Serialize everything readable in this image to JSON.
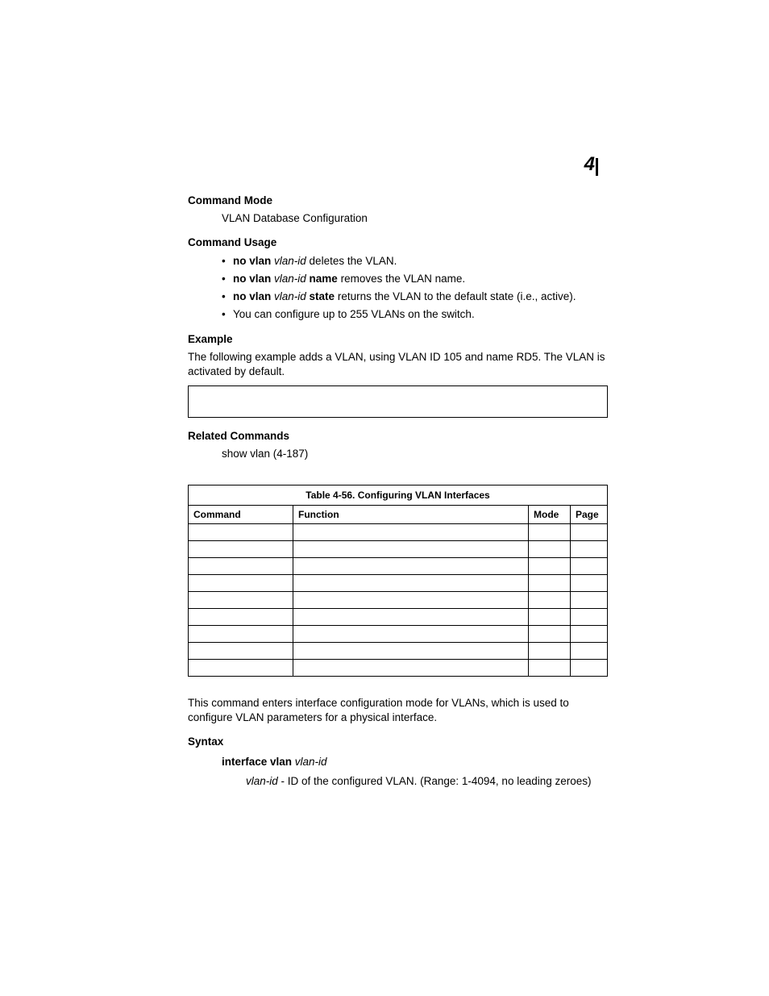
{
  "chapter": "4",
  "sections": {
    "command_mode": {
      "heading": "Command Mode",
      "text": "VLAN Database Configuration"
    },
    "command_usage": {
      "heading": "Command Usage",
      "bullets": [
        {
          "pre": "no vlan ",
          "param": "vlan-id",
          "post": " deletes the VLAN."
        },
        {
          "pre": "no vlan ",
          "param": "vlan-id",
          "kw": " name",
          "post": " removes the VLAN name."
        },
        {
          "pre": "no vlan ",
          "param": "vlan-id",
          "kw": " state",
          "post": " returns the VLAN to the default state (i.e., active)."
        },
        {
          "plain": "You can configure up to 255 VLANs on the switch."
        }
      ]
    },
    "example": {
      "heading": "Example",
      "text": "The following example adds a VLAN, using VLAN ID 105 and name RD5. The VLAN is activated by default."
    },
    "related": {
      "heading": "Related Commands",
      "text": "show vlan (4-187)"
    },
    "table": {
      "caption": "Table 4-56.  Configuring VLAN Interfaces",
      "headers": {
        "command": "Command",
        "function": "Function",
        "mode": "Mode",
        "page": "Page"
      },
      "rows": [
        {
          "command": "",
          "function": "",
          "mode": "",
          "page": ""
        },
        {
          "command": "",
          "function": "",
          "mode": "",
          "page": ""
        },
        {
          "command": "",
          "function": "",
          "mode": "",
          "page": ""
        },
        {
          "command": "",
          "function": "",
          "mode": "",
          "page": ""
        },
        {
          "command": "",
          "function": "",
          "mode": "",
          "page": ""
        },
        {
          "command": "",
          "function": "",
          "mode": "",
          "page": ""
        },
        {
          "command": "",
          "function": "",
          "mode": "",
          "page": ""
        },
        {
          "command": "",
          "function": "",
          "mode": "",
          "page": ""
        },
        {
          "command": "",
          "function": "",
          "mode": "",
          "page": ""
        }
      ]
    },
    "description": "This command enters interface configuration mode for VLANs, which is used to configure VLAN parameters for a physical interface.",
    "syntax": {
      "heading": "Syntax",
      "cmd_pre": "interface vlan ",
      "cmd_param": "vlan-id",
      "desc_param": "vlan-id",
      "desc_post": " - ID of the configured VLAN. (Range: 1-4094, no leading zeroes)"
    }
  }
}
